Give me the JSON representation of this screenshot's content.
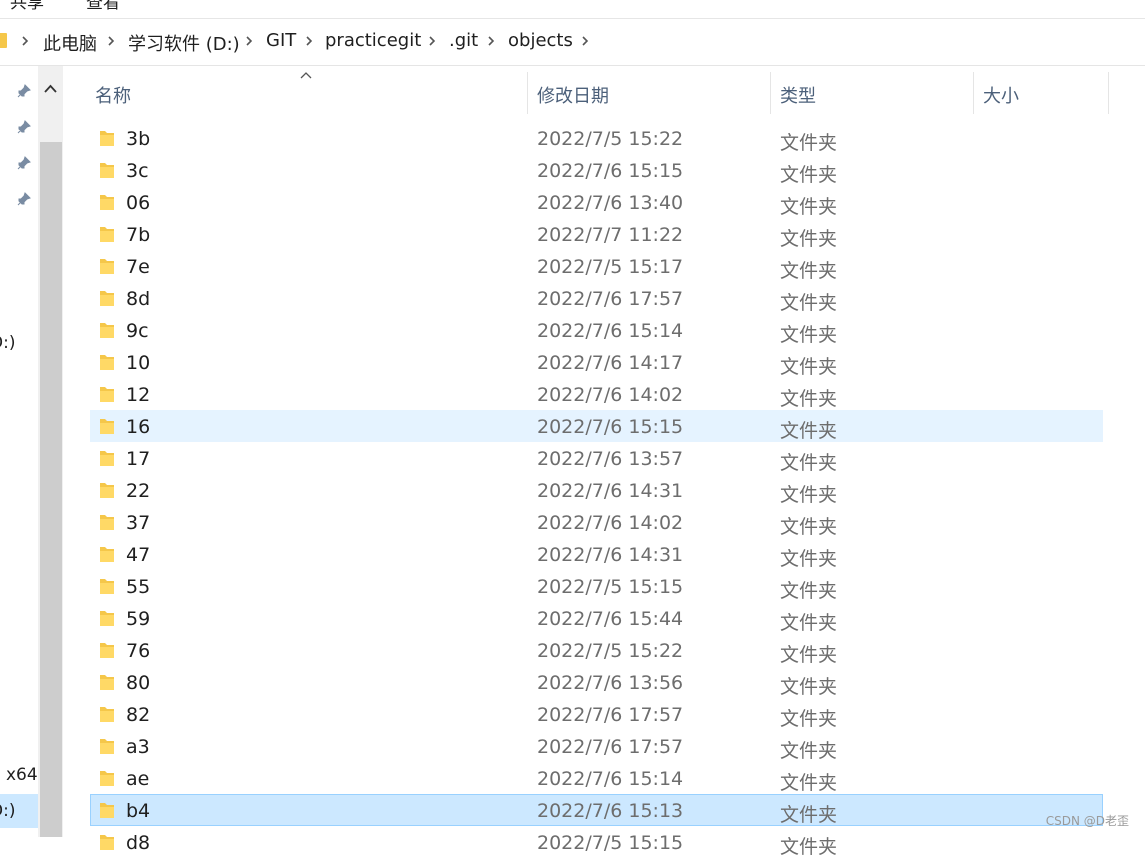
{
  "ribbon": {
    "tabs": [
      "共享",
      "查看"
    ]
  },
  "address_bar": {
    "breadcrumbs": [
      "此电脑",
      "学习软件 (D:)",
      "GIT",
      "practicegit",
      ".git",
      "objects"
    ]
  },
  "nav_pane": {
    "partial_labels": [
      "D:)",
      "x64",
      "D:)"
    ]
  },
  "columns": {
    "name": "名称",
    "modified": "修改日期",
    "type": "类型",
    "size": "大小"
  },
  "files": [
    {
      "name": "3b",
      "modified": "2022/7/5 15:22",
      "type": "文件夹",
      "state": "normal"
    },
    {
      "name": "3c",
      "modified": "2022/7/6 15:15",
      "type": "文件夹",
      "state": "normal"
    },
    {
      "name": "06",
      "modified": "2022/7/6 13:40",
      "type": "文件夹",
      "state": "normal"
    },
    {
      "name": "7b",
      "modified": "2022/7/7 11:22",
      "type": "文件夹",
      "state": "normal"
    },
    {
      "name": "7e",
      "modified": "2022/7/5 15:17",
      "type": "文件夹",
      "state": "normal"
    },
    {
      "name": "8d",
      "modified": "2022/7/6 17:57",
      "type": "文件夹",
      "state": "normal"
    },
    {
      "name": "9c",
      "modified": "2022/7/6 15:14",
      "type": "文件夹",
      "state": "normal"
    },
    {
      "name": "10",
      "modified": "2022/7/6 14:17",
      "type": "文件夹",
      "state": "normal"
    },
    {
      "name": "12",
      "modified": "2022/7/6 14:02",
      "type": "文件夹",
      "state": "normal"
    },
    {
      "name": "16",
      "modified": "2022/7/6 15:15",
      "type": "文件夹",
      "state": "hover"
    },
    {
      "name": "17",
      "modified": "2022/7/6 13:57",
      "type": "文件夹",
      "state": "normal"
    },
    {
      "name": "22",
      "modified": "2022/7/6 14:31",
      "type": "文件夹",
      "state": "normal"
    },
    {
      "name": "37",
      "modified": "2022/7/6 14:02",
      "type": "文件夹",
      "state": "normal"
    },
    {
      "name": "47",
      "modified": "2022/7/6 14:31",
      "type": "文件夹",
      "state": "normal"
    },
    {
      "name": "55",
      "modified": "2022/7/5 15:15",
      "type": "文件夹",
      "state": "normal"
    },
    {
      "name": "59",
      "modified": "2022/7/6 15:44",
      "type": "文件夹",
      "state": "normal"
    },
    {
      "name": "76",
      "modified": "2022/7/5 15:22",
      "type": "文件夹",
      "state": "normal"
    },
    {
      "name": "80",
      "modified": "2022/7/6 13:56",
      "type": "文件夹",
      "state": "normal"
    },
    {
      "name": "82",
      "modified": "2022/7/6 17:57",
      "type": "文件夹",
      "state": "normal"
    },
    {
      "name": "a3",
      "modified": "2022/7/6 17:57",
      "type": "文件夹",
      "state": "normal"
    },
    {
      "name": "ae",
      "modified": "2022/7/6 15:14",
      "type": "文件夹",
      "state": "normal"
    },
    {
      "name": "b4",
      "modified": "2022/7/6 15:13",
      "type": "文件夹",
      "state": "selected"
    },
    {
      "name": "d8",
      "modified": "2022/7/5 15:15",
      "type": "文件夹",
      "state": "normal"
    }
  ],
  "watermark": "CSDN @D老歪",
  "colors": {
    "selection": "#cce8ff",
    "hover": "#e5f3ff",
    "folder": "#f5c74a",
    "header_text": "#4c607a"
  }
}
